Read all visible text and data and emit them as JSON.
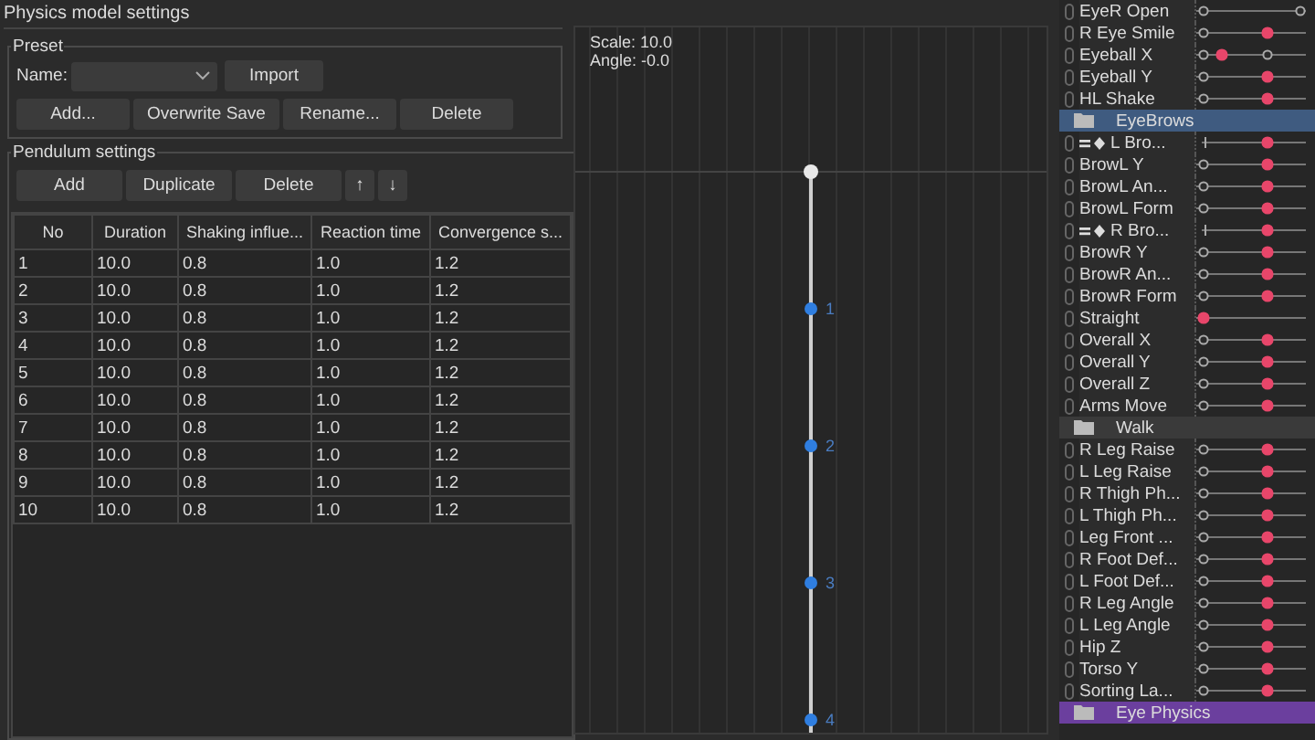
{
  "window": {
    "title": "Physics model settings"
  },
  "preset": {
    "title": "Preset",
    "name_label": "Name:",
    "buttons_top": [
      "Import"
    ],
    "buttons": [
      "Add...",
      "Overwrite Save",
      "Rename...",
      "Delete"
    ]
  },
  "pendulum": {
    "title": "Pendulum settings",
    "buttons": [
      "Add",
      "Duplicate",
      "Delete",
      "↑",
      "↓"
    ],
    "table": {
      "columns": [
        "No",
        "Duration",
        "Shaking influe...",
        "Reaction time",
        "Convergence s..."
      ],
      "rows": [
        [
          "1",
          "10.0",
          "0.8",
          "1.0",
          "1.2"
        ],
        [
          "2",
          "10.0",
          "0.8",
          "1.0",
          "1.2"
        ],
        [
          "3",
          "10.0",
          "0.8",
          "1.0",
          "1.2"
        ],
        [
          "4",
          "10.0",
          "0.8",
          "1.0",
          "1.2"
        ],
        [
          "5",
          "10.0",
          "0.8",
          "1.0",
          "1.2"
        ],
        [
          "6",
          "10.0",
          "0.8",
          "1.0",
          "1.2"
        ],
        [
          "7",
          "10.0",
          "0.8",
          "1.0",
          "1.2"
        ],
        [
          "8",
          "10.0",
          "0.8",
          "1.0",
          "1.2"
        ],
        [
          "9",
          "10.0",
          "0.8",
          "1.0",
          "1.2"
        ],
        [
          "10",
          "10.0",
          "0.8",
          "1.0",
          "1.2"
        ]
      ]
    }
  },
  "preview": {
    "scale": "Scale: 10.0",
    "angle": "Angle: -0.0",
    "points": [
      "1",
      "2",
      "3",
      "4"
    ]
  },
  "parameters": [
    {
      "kind": "param",
      "name": "EyeR Open",
      "track": {
        "kind": "open"
      }
    },
    {
      "kind": "param",
      "name": "R Eye Smile",
      "track": {
        "kind": "standard"
      }
    },
    {
      "kind": "param",
      "name": "Eyeball X",
      "track": {
        "kind": "left"
      }
    },
    {
      "kind": "param",
      "name": "Eyeball Y",
      "track": {
        "kind": "standard"
      }
    },
    {
      "kind": "param",
      "name": "HL Shake",
      "track": {
        "kind": "standard"
      }
    },
    {
      "kind": "folder",
      "name": "EyeBrows",
      "color": "#3f5b80"
    },
    {
      "kind": "group",
      "name": "L Bro...",
      "track": {
        "kind": "tick"
      }
    },
    {
      "kind": "param",
      "name": "BrowL Y",
      "track": {
        "kind": "standard"
      }
    },
    {
      "kind": "param",
      "name": "BrowL An...",
      "track": {
        "kind": "standard"
      }
    },
    {
      "kind": "param",
      "name": "BrowL Form",
      "track": {
        "kind": "standard"
      }
    },
    {
      "kind": "group",
      "name": "R Bro...",
      "track": {
        "kind": "tick"
      }
    },
    {
      "kind": "param",
      "name": "BrowR Y",
      "track": {
        "kind": "standard"
      }
    },
    {
      "kind": "param",
      "name": "BrowR An...",
      "track": {
        "kind": "standard"
      }
    },
    {
      "kind": "param",
      "name": "BrowR Form",
      "track": {
        "kind": "standard"
      }
    },
    {
      "kind": "param",
      "name": "Straight",
      "track": {
        "kind": "start"
      }
    },
    {
      "kind": "param",
      "name": "Overall X",
      "track": {
        "kind": "standard"
      }
    },
    {
      "kind": "param",
      "name": "Overall Y",
      "track": {
        "kind": "standard"
      }
    },
    {
      "kind": "param",
      "name": "Overall Z",
      "track": {
        "kind": "standard"
      }
    },
    {
      "kind": "param",
      "name": "Arms Move",
      "track": {
        "kind": "standard"
      }
    },
    {
      "kind": "folder",
      "name": "Walk",
      "color": "#3a3a3a"
    },
    {
      "kind": "param",
      "name": "R Leg Raise",
      "track": {
        "kind": "standard"
      }
    },
    {
      "kind": "param",
      "name": "L Leg Raise",
      "track": {
        "kind": "standard"
      }
    },
    {
      "kind": "param",
      "name": "R Thigh Ph...",
      "track": {
        "kind": "standard"
      }
    },
    {
      "kind": "param",
      "name": "L Thigh Ph...",
      "track": {
        "kind": "standard"
      }
    },
    {
      "kind": "param",
      "name": "Leg Front ...",
      "track": {
        "kind": "standard"
      }
    },
    {
      "kind": "param",
      "name": "R Foot Def...",
      "track": {
        "kind": "standard"
      }
    },
    {
      "kind": "param",
      "name": "L Foot Def...",
      "track": {
        "kind": "standard"
      }
    },
    {
      "kind": "param",
      "name": "R Leg Angle",
      "track": {
        "kind": "standard"
      }
    },
    {
      "kind": "param",
      "name": "L Leg Angle",
      "track": {
        "kind": "standard"
      }
    },
    {
      "kind": "param",
      "name": "Hip Z",
      "track": {
        "kind": "standard"
      }
    },
    {
      "kind": "param",
      "name": "Torso Y",
      "track": {
        "kind": "standard"
      }
    },
    {
      "kind": "param",
      "name": "Sorting La...",
      "track": {
        "kind": "standard"
      }
    },
    {
      "kind": "folder",
      "name": "Eye Physics",
      "color": "#6b3f9e"
    }
  ]
}
